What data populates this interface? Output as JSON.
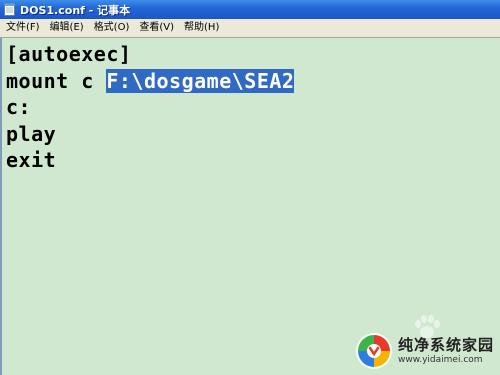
{
  "window": {
    "title": "DOS1.conf - 记事本",
    "icon": "notepad-icon"
  },
  "menu": {
    "items": [
      {
        "label": "文件(F)"
      },
      {
        "label": "编辑(E)"
      },
      {
        "label": "格式(O)"
      },
      {
        "label": "查看(V)"
      },
      {
        "label": "帮助(H)"
      }
    ]
  },
  "editor": {
    "lines": [
      {
        "text": "[autoexec]"
      },
      {
        "prefix": "mount c ",
        "selected": "F:\\dosgame\\SEA2"
      },
      {
        "text": "c:"
      },
      {
        "text": "play"
      },
      {
        "text": "exit"
      }
    ],
    "selection_color": "#316ac5",
    "background_color": "#cfe8cf"
  },
  "watermark": {
    "name": "纯净系统家园",
    "url": "www.yidaimei.com"
  }
}
